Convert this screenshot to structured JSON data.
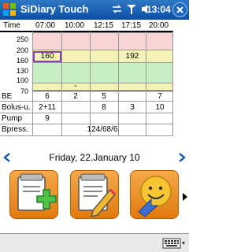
{
  "app": {
    "title": "SiDiary Touch",
    "clock": "13:04"
  },
  "grid": {
    "header_label": "Time",
    "times": [
      "07:00",
      "10:00",
      "12:15",
      "17:15",
      "20:00"
    ],
    "yticks": [
      "250",
      "200",
      "160",
      "130",
      "100",
      "70"
    ],
    "row_labels": [
      "BE",
      "Bolus-u.",
      "Pump",
      "Bpress."
    ],
    "glucose": [
      "160",
      "",
      "",
      "192",
      ""
    ],
    "minus_marker": "-",
    "be": [
      "6",
      "2",
      "5",
      "",
      "7"
    ],
    "bolus": [
      "2+11",
      "",
      "8",
      "3",
      "10"
    ],
    "pump": [
      "9",
      "",
      "",
      "",
      ""
    ],
    "bpress": "124/68/6"
  },
  "date": {
    "label": "Friday, 22.January 10"
  },
  "colors": {
    "red_band": "#f8d4d4",
    "yellow_band": "#f5f2b8",
    "green_band": "#c9eec6",
    "accent": "#0c4fa4",
    "button": "#f08f1e"
  },
  "icons": {
    "new_entry": "document-plus-icon",
    "edit_entry": "document-pencil-icon",
    "smiley": "smiley-icon"
  }
}
